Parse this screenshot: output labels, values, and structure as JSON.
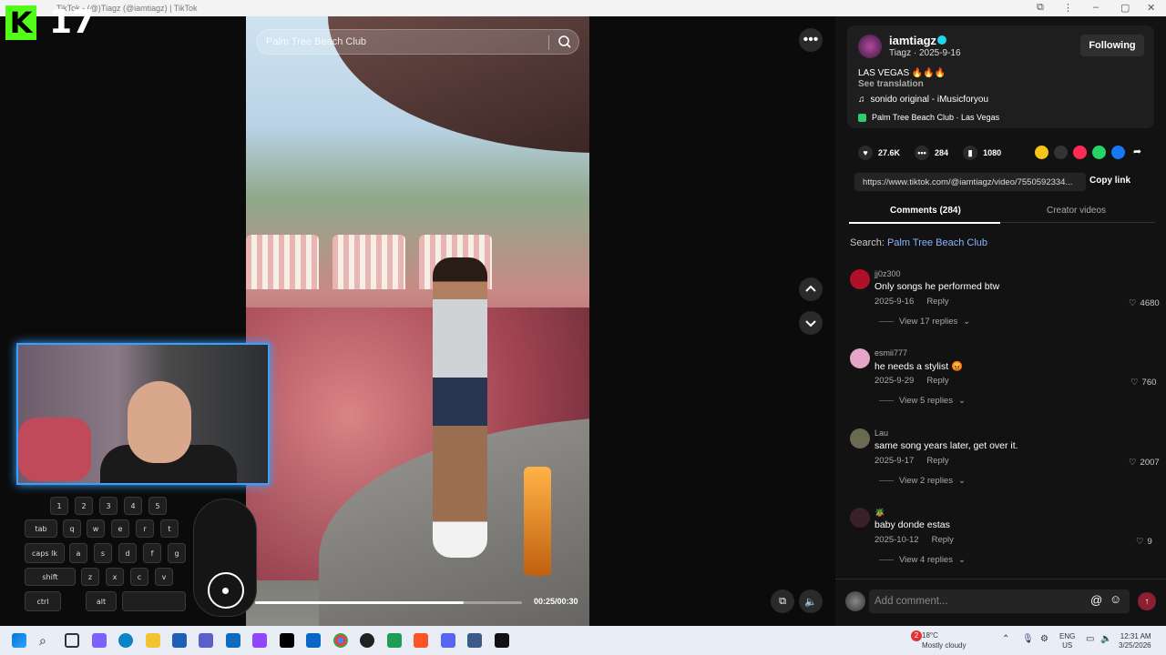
{
  "browser": {
    "tab_title": "TikTok - (@)Tiagz (@iamtiagz) | TikTok"
  },
  "overlay": {
    "logo_letter": "K",
    "counter": "17"
  },
  "video": {
    "search_placeholder": "Palm Tree Beach Club",
    "time": "00:25/00:30",
    "progress_fraction": 0.78
  },
  "keyboard": {
    "numbers": [
      "1",
      "2",
      "3",
      "4",
      "5"
    ],
    "row2": [
      "tab",
      "q",
      "w",
      "e",
      "r",
      "t"
    ],
    "row3": [
      "caps lk",
      "a",
      "s",
      "d",
      "f",
      "g"
    ],
    "row4": [
      "shift",
      "z",
      "x",
      "c",
      "v"
    ],
    "row5": [
      "ctrl",
      "alt"
    ]
  },
  "post": {
    "username": "iamtiagz",
    "subline": "Tiagz · 2025-9-16",
    "follow_label": "Following",
    "caption": "LAS VEGAS 🔥🔥🔥",
    "see_translation": "See translation",
    "music": "sonido original - iMusicforyou",
    "location": "Palm Tree Beach Club · Las Vegas",
    "likes": "27.6K",
    "comments": "284",
    "saves": "1080",
    "link": "https://www.tiktok.com/@iamtiagz/video/7550592334...",
    "copy_link": "Copy link"
  },
  "tabs": {
    "comments": "Comments (284)",
    "creator": "Creator videos"
  },
  "search_row": {
    "prefix": "Search: ",
    "query": "Palm Tree Beach Club"
  },
  "comments": [
    {
      "user": "jj0z300",
      "text": "Only songs he performed btw",
      "date": "2025-9-16",
      "reply": "Reply",
      "likes": "4680",
      "replies": "View 17 replies",
      "avatar_color": "#b0102a"
    },
    {
      "user": "esmii777",
      "text": "he needs a stylist 😡",
      "date": "2025-9-29",
      "reply": "Reply",
      "likes": "760",
      "replies": "View 5 replies",
      "avatar_color": "#e6a4c8"
    },
    {
      "user": "Lau",
      "text": "same song years later, get over it.",
      "date": "2025-9-17",
      "reply": "Reply",
      "likes": "2007",
      "replies": "View 2 replies",
      "avatar_color": "#6a6a52"
    },
    {
      "user": "🪴",
      "text": "baby donde estas",
      "date": "2025-10-12",
      "reply": "Reply",
      "likes": "9",
      "replies": "View 4 replies",
      "avatar_color": "#3a2028"
    }
  ],
  "comment_bar": {
    "placeholder": "Add comment...",
    "send": "↑"
  },
  "taskbar": {
    "weather_temp": "18°C",
    "weather_desc": "Mostly cloudy",
    "weather_badge": "2",
    "lang_1": "ENG",
    "lang_2": "US",
    "time": "12:31 AM",
    "date": "3/25/2026"
  }
}
